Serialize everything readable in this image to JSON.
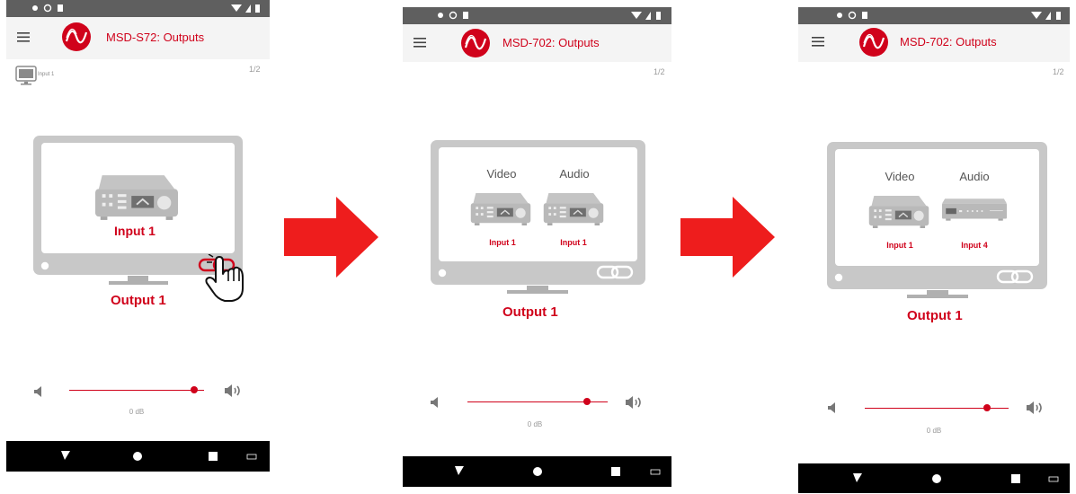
{
  "screens": [
    {
      "title": "MSD-S72: Outputs",
      "pager": "1/2",
      "mini_input_label": "Input 1",
      "input_label": "Input 1",
      "output_label": "Output 1",
      "volume_label": "0 dB",
      "volume_level": 0.89
    },
    {
      "title": "MSD-702: Outputs",
      "pager": "1/2",
      "video_header": "Video",
      "audio_header": "Audio",
      "video_source": "Input 1",
      "audio_source": "Input 1",
      "output_label": "Output 1",
      "volume_label": "0 dB",
      "volume_level": 0.85
    },
    {
      "title": "MSD-702: Outputs",
      "pager": "1/2",
      "video_header": "Video",
      "audio_header": "Audio",
      "video_source": "Input 1",
      "audio_source": "Input 4",
      "output_label": "Output 1",
      "volume_label": "0 dB",
      "volume_level": 0.85
    }
  ],
  "colors": {
    "accent": "#d0021b",
    "tv_frame": "#c8c8c8",
    "statusbar": "#5f5f5f",
    "navbar": "#000000"
  },
  "icons": [
    "menu-icon",
    "brand-logo-icon",
    "monitor-icon",
    "receiver-icon",
    "link-icon",
    "hand-pointer-icon",
    "volume-low-icon",
    "volume-high-icon",
    "back-icon",
    "home-icon",
    "recents-icon",
    "keyboard-icon",
    "arrow-right-icon"
  ]
}
